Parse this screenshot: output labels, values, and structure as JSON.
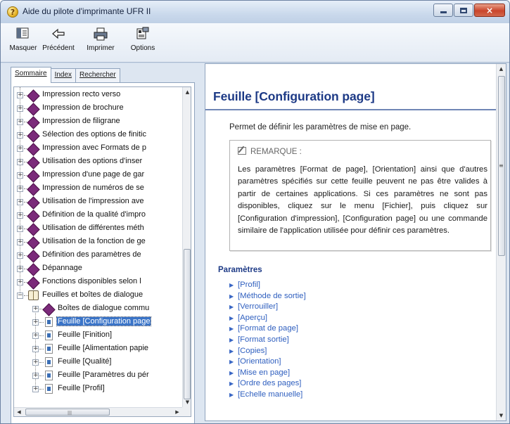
{
  "window": {
    "title": "Aide du pilote d'imprimante UFR II",
    "buttons": {
      "minimize": "minimize",
      "maximize": "maximize",
      "close": "×"
    }
  },
  "toolbar": {
    "items": [
      {
        "label": "Masquer",
        "icon": "hide-pane-icon"
      },
      {
        "label": "Précédent",
        "icon": "back-arrow-icon"
      },
      {
        "label": "Imprimer",
        "icon": "printer-icon"
      },
      {
        "label": "Options",
        "icon": "options-icon"
      }
    ]
  },
  "tabs": [
    {
      "label": "Sommaire",
      "active": true
    },
    {
      "label": "Index",
      "active": false
    },
    {
      "label": "Rechercher",
      "active": false
    }
  ],
  "tree": {
    "items": [
      {
        "label": "Impression recto verso",
        "icon": "book-icon"
      },
      {
        "label": "Impression de brochure",
        "icon": "book-icon"
      },
      {
        "label": "Impression de filigrane",
        "icon": "book-icon"
      },
      {
        "label": "Sélection des options de finitic",
        "icon": "book-icon"
      },
      {
        "label": "Impression avec Formats de p",
        "icon": "book-icon"
      },
      {
        "label": "Utilisation des options d'inser",
        "icon": "book-icon"
      },
      {
        "label": "Impression d'une page de gar",
        "icon": "book-icon"
      },
      {
        "label": "Impression de numéros de se",
        "icon": "book-icon"
      },
      {
        "label": "Utilisation de l'impression ave",
        "icon": "book-icon"
      },
      {
        "label": "Définition de la qualité d'impro",
        "icon": "book-icon"
      },
      {
        "label": "Utilisation de différentes méth",
        "icon": "book-icon"
      },
      {
        "label": "Utilisation de la fonction de ge",
        "icon": "book-icon"
      },
      {
        "label": "Définition des paramètres de",
        "icon": "book-icon"
      },
      {
        "label": "Dépannage",
        "icon": "book-icon"
      },
      {
        "label": "Fonctions disponibles selon l",
        "icon": "book-icon"
      },
      {
        "label": "Feuilles et boîtes de dialogue",
        "icon": "open-book-icon"
      },
      {
        "label": "Boîtes de dialogue commu",
        "icon": "book-icon"
      },
      {
        "label": "Feuille [Configuration page",
        "icon": "page-icon",
        "selected": true
      },
      {
        "label": "Feuille [Finition]",
        "icon": "page-icon"
      },
      {
        "label": "Feuille [Alimentation papie",
        "icon": "page-icon"
      },
      {
        "label": "Feuille [Qualité]",
        "icon": "page-icon"
      },
      {
        "label": "Feuille [Paramètres du pér",
        "icon": "page-icon"
      },
      {
        "label": "Feuille [Profil]",
        "icon": "page-icon"
      }
    ]
  },
  "doc": {
    "title": "Feuille [Configuration page]",
    "intro": "Permet de définir les paramètres de mise en page.",
    "note_heading": "REMARQUE :",
    "note_body": "Les paramètres [Format de page], [Orientation] ainsi que d'autres paramètres spécifiés sur cette feuille peuvent ne pas être valides à partir de certaines applications. Si ces paramètres ne sont pas disponibles, cliquez sur le menu [Fichier], puis cliquez sur [Configuration d'impression], [Configuration page] ou une commande similaire de l'application utilisée pour définir ces paramètres.",
    "params_heading": "Paramètres",
    "params": [
      "[Profil]",
      "[Méthode de sortie]",
      "[Verrouiller]",
      "[Aperçu]",
      "[Format de page]",
      "[Format sortie]",
      "[Copies]",
      "[Orientation]",
      "[Mise en page]",
      "[Ordre des pages]",
      "[Echelle manuelle]"
    ]
  },
  "colors": {
    "heading": "#1d3a86",
    "link": "#2f5fbf",
    "selection": "#3a74c8",
    "book": "#7b2a7a"
  }
}
